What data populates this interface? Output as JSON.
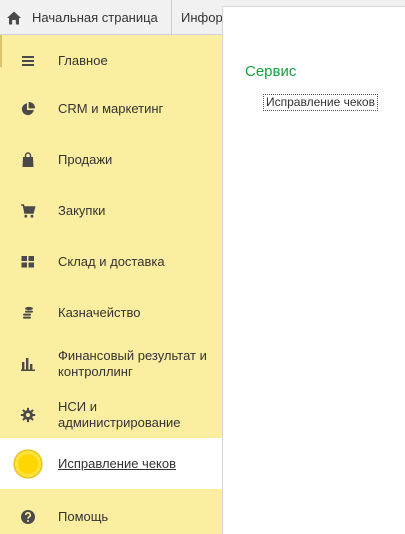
{
  "tabs": {
    "home_label": "Начальная страница",
    "second_label": "Информ"
  },
  "sidebar": {
    "items": [
      {
        "label": "Главное",
        "icon": "menu-lines-icon"
      },
      {
        "label": "CRM и маркетинг",
        "icon": "pie-chart-icon"
      },
      {
        "label": "Продажи",
        "icon": "shopping-bag-icon"
      },
      {
        "label": "Закупки",
        "icon": "shopping-cart-icon"
      },
      {
        "label": "Склад и доставка",
        "icon": "grid-blocks-icon"
      },
      {
        "label": "Казначейство",
        "icon": "coins-stack-icon"
      },
      {
        "label": "Финансовый результат и контроллинг",
        "icon": "bar-chart-icon"
      },
      {
        "label": "НСИ и администрирование",
        "icon": "gear-icon"
      },
      {
        "label": "Исправление чеков",
        "icon": "yellow-circle-icon",
        "active": true
      },
      {
        "label": "Помощь",
        "icon": "help-circle-icon"
      }
    ]
  },
  "panel": {
    "section_title": "Сервис",
    "link_label": "Исправление чеков"
  },
  "colors": {
    "sidebar_bg": "#fbeea0",
    "section_title": "#19a33d",
    "icon": "#4a4a4a",
    "active_circle": "#ffd600"
  }
}
